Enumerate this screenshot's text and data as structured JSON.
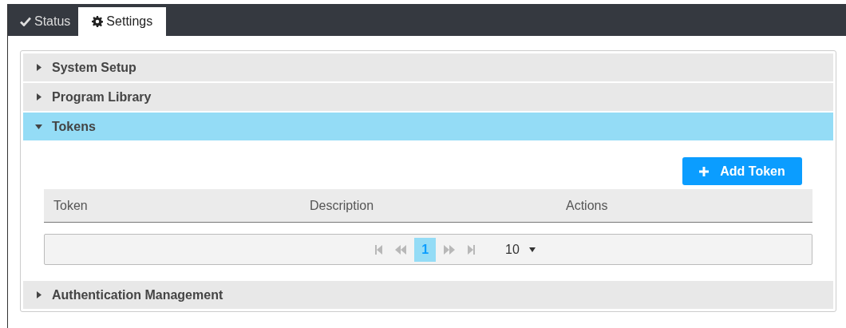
{
  "tabs": [
    {
      "label": "Status",
      "kind": "status",
      "selected": false
    },
    {
      "label": "Settings",
      "kind": "settings",
      "selected": true
    }
  ],
  "sections": [
    {
      "title": "System Setup",
      "expanded": false
    },
    {
      "title": "Program Library",
      "expanded": false
    },
    {
      "title": "Tokens",
      "expanded": true,
      "content": {
        "add_button": "Add Token",
        "table": {
          "columns": [
            "Token",
            "Description",
            "Actions"
          ]
        },
        "pager": {
          "pages": [
            {
              "label": "1",
              "selected": true
            }
          ],
          "page_size": "10"
        }
      }
    },
    {
      "title": "Authentication Management",
      "expanded": false
    }
  ]
}
